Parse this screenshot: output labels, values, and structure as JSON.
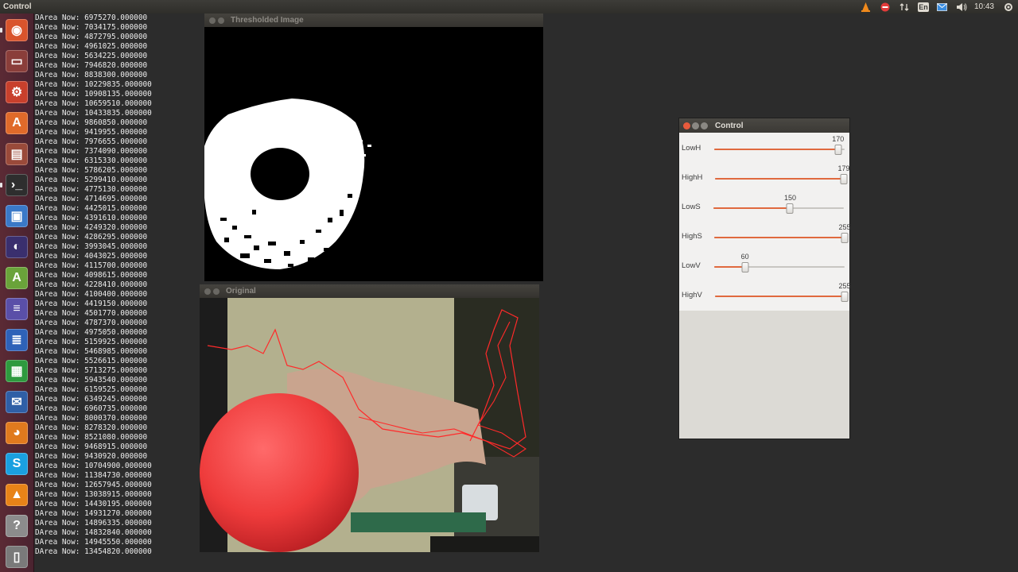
{
  "top_panel": {
    "title": "Control",
    "keyboard": "En",
    "clock": "10:43"
  },
  "launcher": {
    "items": [
      {
        "icon": "ubuntu-dash-icon",
        "color": "#d9542c"
      },
      {
        "icon": "files-icon",
        "color": "#8a3e3a"
      },
      {
        "icon": "system-settings-icon",
        "color": "#c8402c"
      },
      {
        "icon": "software-center-icon",
        "color": "#e06a2a"
      },
      {
        "icon": "archive-icon",
        "color": "#9a4a3a"
      },
      {
        "icon": "terminal-icon",
        "color": "#2e2e2e"
      },
      {
        "icon": "cube-app-icon",
        "color": "#3a79c8"
      },
      {
        "icon": "eclipse-icon",
        "color": "#3a2f6e"
      },
      {
        "icon": "android-studio-icon",
        "color": "#6aa33a"
      },
      {
        "icon": "mathematica-icon",
        "color": "#5a4fa8"
      },
      {
        "icon": "writer-icon",
        "color": "#2e62b8"
      },
      {
        "icon": "calc-icon",
        "color": "#2e9a3e"
      },
      {
        "icon": "thunderbird-icon",
        "color": "#2f5fa6"
      },
      {
        "icon": "firefox-icon",
        "color": "#e07a1e"
      },
      {
        "icon": "skype-icon",
        "color": "#1aa0e0"
      },
      {
        "icon": "vlc-icon",
        "color": "#e88318"
      },
      {
        "icon": "help-icon",
        "color": "#8c8c8c"
      },
      {
        "icon": "trash-icon",
        "color": "#7a7a7a"
      }
    ]
  },
  "terminal": {
    "lines": [
      "DArea Now: 6975270.000000",
      "DArea Now: 7034175.000000",
      "DArea Now: 4872795.000000",
      "DArea Now: 4961025.000000",
      "DArea Now: 5634225.000000",
      "DArea Now: 7946820.000000",
      "DArea Now: 8838300.000000",
      "DArea Now: 10229835.000000",
      "DArea Now: 10908135.000000",
      "DArea Now: 10659510.000000",
      "DArea Now: 10433835.000000",
      "DArea Now: 9860850.000000",
      "DArea Now: 9419955.000000",
      "DArea Now: 7976655.000000",
      "DArea Now: 7374090.000000",
      "DArea Now: 6315330.000000",
      "DArea Now: 5786205.000000",
      "DArea Now: 5299410.000000",
      "DArea Now: 4775130.000000",
      "DArea Now: 4714695.000000",
      "DArea Now: 4425015.000000",
      "DArea Now: 4391610.000000",
      "DArea Now: 4249320.000000",
      "DArea Now: 4286295.000000",
      "DArea Now: 3993045.000000",
      "DArea Now: 4043025.000000",
      "DArea Now: 4115700.000000",
      "DArea Now: 4098615.000000",
      "DArea Now: 4228410.000000",
      "DArea Now: 4100400.000000",
      "DArea Now: 4419150.000000",
      "DArea Now: 4501770.000000",
      "DArea Now: 4787370.000000",
      "DArea Now: 4975050.000000",
      "DArea Now: 5159925.000000",
      "DArea Now: 5468985.000000",
      "DArea Now: 5526615.000000",
      "DArea Now: 5713275.000000",
      "DArea Now: 5943540.000000",
      "DArea Now: 6159525.000000",
      "DArea Now: 6349245.000000",
      "DArea Now: 6960735.000000",
      "DArea Now: 8000370.000000",
      "DArea Now: 8278320.000000",
      "DArea Now: 8521080.000000",
      "DArea Now: 9468915.000000",
      "DArea Now: 9430920.000000",
      "DArea Now: 10704900.000000",
      "DArea Now: 11384730.000000",
      "DArea Now: 12657945.000000",
      "DArea Now: 13038915.000000",
      "DArea Now: 14430195.000000",
      "DArea Now: 14931270.000000",
      "DArea Now: 14896335.000000",
      "DArea Now: 14832840.000000",
      "DArea Now: 14945550.000000",
      "DArea Now: 13454820.000000"
    ]
  },
  "thresholded_window": {
    "title": "Thresholded Image"
  },
  "original_window": {
    "title": "Original"
  },
  "control_window": {
    "title": "Control",
    "sliders": [
      {
        "label": "LowH",
        "value": 170,
        "max": 179
      },
      {
        "label": "HighH",
        "value": 179,
        "max": 179
      },
      {
        "label": "LowS",
        "value": 150,
        "max": 255
      },
      {
        "label": "HighS",
        "value": 255,
        "max": 255
      },
      {
        "label": "LowV",
        "value": 60,
        "max": 255
      },
      {
        "label": "HighV",
        "value": 255,
        "max": 255
      }
    ]
  }
}
